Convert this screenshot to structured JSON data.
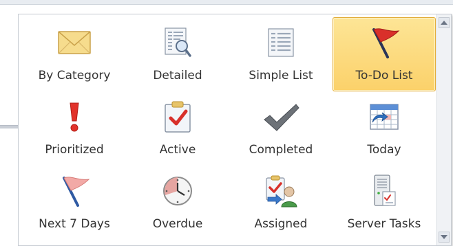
{
  "gallery": {
    "items": [
      {
        "label": "By Category",
        "icon": "envelope-icon"
      },
      {
        "label": "Detailed",
        "icon": "detailed-view-icon"
      },
      {
        "label": "Simple List",
        "icon": "simple-list-icon"
      },
      {
        "label": "To-Do List",
        "icon": "red-flag-icon",
        "selected": true
      },
      {
        "label": "Prioritized",
        "icon": "exclamation-icon"
      },
      {
        "label": "Active",
        "icon": "clipboard-check-icon"
      },
      {
        "label": "Completed",
        "icon": "checkmark-icon"
      },
      {
        "label": "Today",
        "icon": "calendar-today-icon"
      },
      {
        "label": "Next 7 Days",
        "icon": "pink-flag-icon"
      },
      {
        "label": "Overdue",
        "icon": "clock-icon"
      },
      {
        "label": "Assigned",
        "icon": "assigned-user-icon"
      },
      {
        "label": "Server Tasks",
        "icon": "server-tasks-icon"
      }
    ]
  },
  "colors": {
    "selected_bg": "#fbd16a",
    "selected_border": "#e2ad3a",
    "text": "#333333"
  }
}
